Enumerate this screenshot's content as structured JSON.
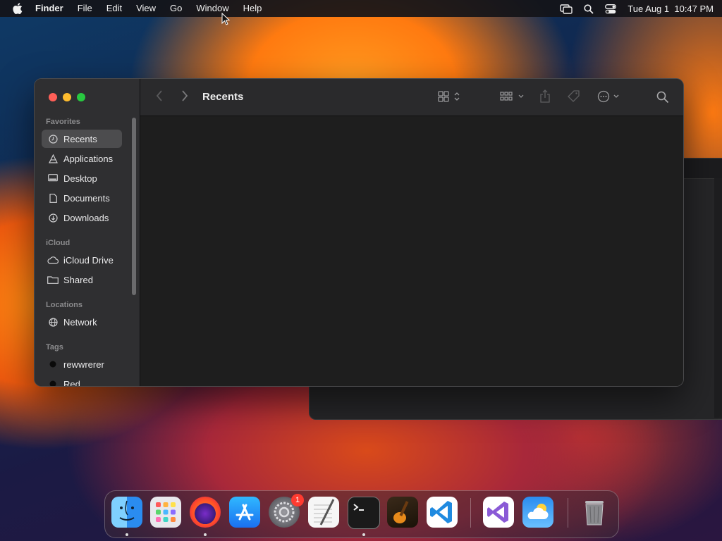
{
  "menubar": {
    "app_name": "Finder",
    "items": [
      "File",
      "Edit",
      "View",
      "Go",
      "Window",
      "Help"
    ],
    "clock": "Tue Aug 1  10:47 PM"
  },
  "finder": {
    "title": "Recents",
    "sidebar": {
      "favorites_label": "Favorites",
      "favorites": [
        "Recents",
        "Applications",
        "Desktop",
        "Documents",
        "Downloads"
      ],
      "icloud_label": "iCloud",
      "icloud": [
        "iCloud Drive",
        "Shared"
      ],
      "locations_label": "Locations",
      "locations": [
        "Network"
      ],
      "tags_label": "Tags",
      "tags": [
        "rewwrerer",
        "Red"
      ]
    },
    "selected": "Recents"
  },
  "dock": {
    "apps": [
      "finder-icon",
      "launchpad-icon",
      "firefox-icon",
      "app-store-icon",
      "system-settings-icon",
      "textedit-icon",
      "terminal-icon",
      "garageband-icon",
      "vscode-icon",
      "visual-studio-icon",
      "weather-icon",
      "trash-icon"
    ],
    "settings_badge": "1"
  },
  "colors": {
    "close": "#ff5f57",
    "minimize": "#febc2e",
    "zoom": "#28c840"
  }
}
